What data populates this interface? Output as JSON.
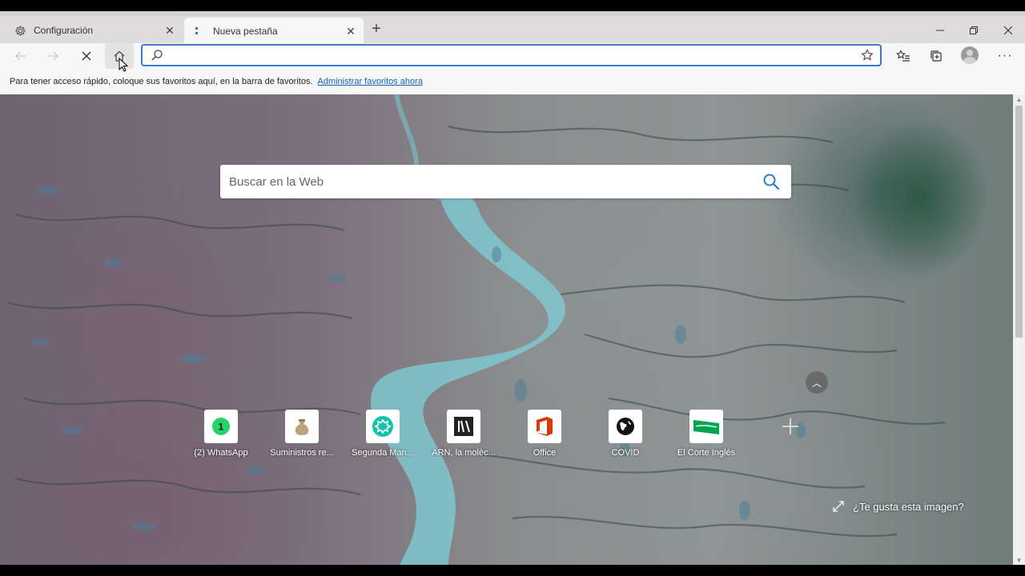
{
  "tabs": [
    {
      "title": "Configuración",
      "icon": "gear-icon",
      "active": false
    },
    {
      "title": "Nueva pestaña",
      "icon": "edge-newtab-icon",
      "active": true
    }
  ],
  "window_controls": [
    "minimize-icon",
    "restore-icon",
    "close-icon"
  ],
  "address_bar": {
    "value": "",
    "placeholder": ""
  },
  "favorites_bar": {
    "text": "Para tener acceso rápido, coloque sus favoritos aquí, en la barra de favoritos.",
    "link": "Administrar favoritos ahora"
  },
  "search": {
    "placeholder": "Buscar en la Web"
  },
  "quick_links": [
    {
      "label": "(2) WhatsApp",
      "icon": "whatsapp-icon",
      "color": "#25d366"
    },
    {
      "label": "Suministros re...",
      "icon": "sack-icon",
      "color": "#b8a67a"
    },
    {
      "label": "Segunda Man...",
      "icon": "segunda-mano-icon",
      "color": "#13c1ac"
    },
    {
      "label": "ARN, la molèc...",
      "icon": "newspaper-icon",
      "color": "#222222"
    },
    {
      "label": "Office",
      "icon": "office-icon",
      "color": "#d83b01"
    },
    {
      "label": "COVID",
      "icon": "globe-icon",
      "color": "#111111"
    },
    {
      "label": "El Corte Inglés",
      "icon": "corte-ingles-icon",
      "color": "#00a64f"
    }
  ],
  "image_feedback": "¿Te gusta esta imagen?",
  "colors": {
    "accent": "#3a7ad6",
    "link": "#1a5fb4",
    "search_icon": "#2a7ad6"
  }
}
